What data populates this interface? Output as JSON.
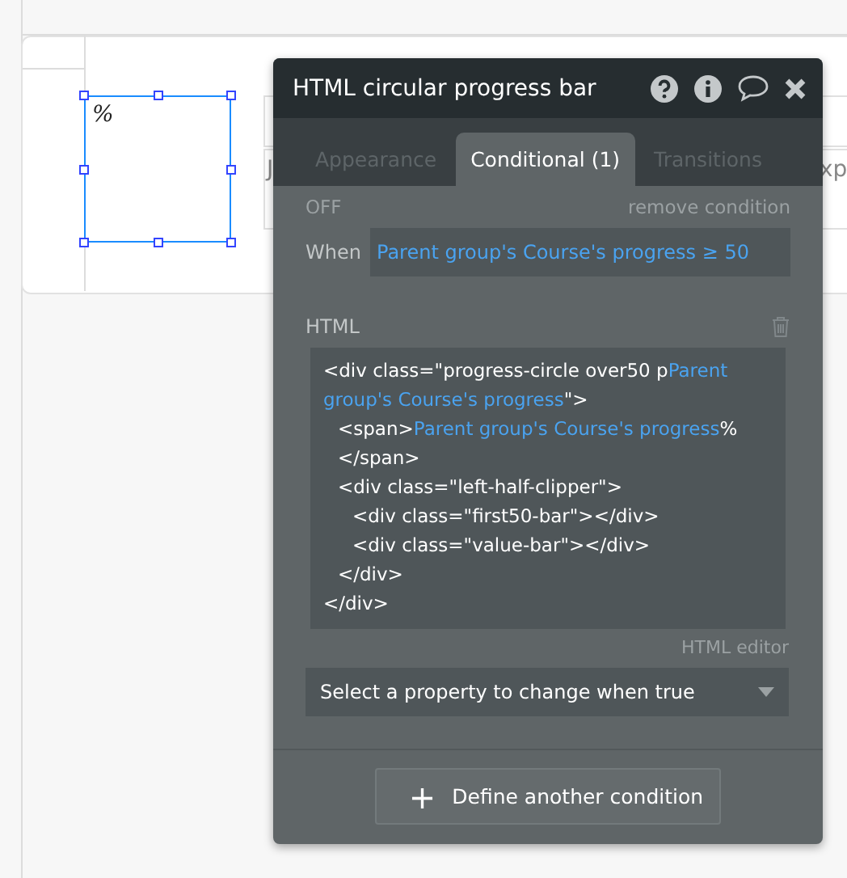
{
  "canvas": {
    "selected_element_text": "%",
    "behind_texts": [
      {
        "text": "J",
        "kind": "body"
      },
      {
        "text": "xp",
        "kind": "body"
      }
    ]
  },
  "panel": {
    "title": "HTML circular progress bar",
    "tabs": [
      {
        "label": "Appearance",
        "selected": false
      },
      {
        "label": "Conditional (1)",
        "selected": true
      },
      {
        "label": "Transitions",
        "selected": false
      }
    ],
    "condition": {
      "status": "OFF",
      "remove_label": "remove condition",
      "when_label": "When",
      "expression": "Parent group's Course's progress ≥ 50"
    },
    "html_label": "HTML",
    "code_lines": [
      {
        "parts": [
          {
            "text": "<div class=\"progress-circle over50 p",
            "kind": "plain"
          },
          {
            "text": "Parent group's Course's progress",
            "kind": "dynamic"
          },
          {
            "text": "\">",
            "kind": "plain"
          }
        ],
        "children": [
          {
            "parts": [
              {
                "text": "<span>",
                "kind": "plain"
              },
              {
                "text": "Parent group's Course's progress",
                "kind": "dynamic"
              },
              {
                "text": "% </span>",
                "kind": "plain"
              }
            ]
          },
          {
            "parts": [
              {
                "text": "<div class=\"left-half-clipper\">",
                "kind": "plain"
              }
            ],
            "children": [
              {
                "parts": [
                  {
                    "text": "<div class=\"first50-bar\"></div>",
                    "kind": "plain"
                  }
                ]
              },
              {
                "parts": [
                  {
                    "text": "<div class=\"value-bar\"></div>",
                    "kind": "plain"
                  }
                ]
              }
            ]
          },
          {
            "parts": [
              {
                "text": "</div>",
                "kind": "plain"
              }
            ]
          }
        ]
      },
      {
        "parts": [
          {
            "text": "</div>",
            "kind": "plain"
          }
        ]
      }
    ],
    "editor_link": "HTML editor",
    "property_dropdown": {
      "placeholder": "Select a property to change when true"
    },
    "define_button": {
      "icon": "+",
      "label": "Define another condition"
    }
  }
}
